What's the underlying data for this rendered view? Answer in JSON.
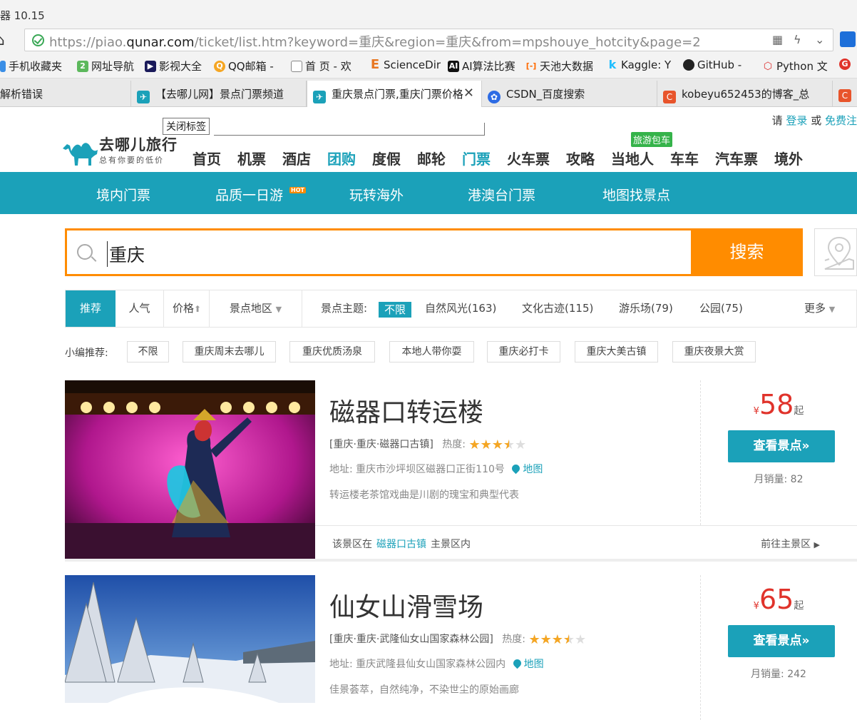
{
  "browser": {
    "title_fragment": "器 10.15",
    "url_prefix": "https://piao.",
    "url_domain": "qunar.com",
    "url_rest": "/ticket/list.htm?keyword=重庆&region=重庆&from=mpshouye_hotcity&page=2",
    "bookmarks": [
      "手机收藏夹",
      "网址导航",
      "影视大全",
      "QQ邮箱 -",
      "首 页 - 欢",
      "ScienceDir",
      "AI算法比赛",
      "天池大数据",
      "Kaggle: Y",
      "GitHub -",
      "Python 文"
    ],
    "tabs": [
      {
        "label": "解析错误"
      },
      {
        "label": "【去哪儿网】景点门票频道"
      },
      {
        "label": "重庆景点门票,重庆门票价格"
      },
      {
        "label": "CSDN_百度搜索"
      },
      {
        "label": "kobeyu652453的博客_总"
      }
    ],
    "tooltip": "关闭标签"
  },
  "header": {
    "login_prefix": "请",
    "login": "登录",
    "or": "或",
    "register": "免费注",
    "logo_title": "去哪儿旅行",
    "logo_slogan": "总有你要的低价",
    "nav": [
      "首页",
      "机票",
      "酒店",
      "团购",
      "度假",
      "邮轮",
      "门票",
      "火车票",
      "攻略",
      "当地人",
      "车车",
      "汽车票",
      "境外"
    ],
    "nav_badge": "旅游包车",
    "subnav": [
      "境内门票",
      "品质一日游",
      "玩转海外",
      "港澳台门票",
      "地图找景点"
    ],
    "hot_badge": "HOT"
  },
  "search": {
    "value": "重庆",
    "button": "搜索"
  },
  "filters": {
    "sort": [
      "推荐",
      "人气",
      "价格"
    ],
    "region": "景点地区",
    "theme_label": "景点主题:",
    "themes": [
      "不限",
      "自然风光(163)",
      "文化古迹(115)",
      "游乐场(79)",
      "公园(75)"
    ],
    "more": "更多"
  },
  "recommend": {
    "label": "小编推荐:",
    "tags": [
      "不限",
      "重庆周末去哪儿",
      "重庆优质汤泉",
      "本地人带你耍",
      "重庆必打卡",
      "重庆大美古镇",
      "重庆夜景大赏"
    ]
  },
  "results": [
    {
      "name": "磁器口转运楼",
      "location": "[重庆·重庆·磁器口古镇]",
      "heat_label": "热度:",
      "heat": 0.7,
      "address": "地址:  重庆市沙坪坝区磁器口正街110号",
      "map": "地图",
      "desc": "转运楼老茶馆戏曲是川剧的瑰宝和典型代表",
      "area_prefix": "该景区在",
      "area_name": "磁器口古镇",
      "area_suffix": "主景区内",
      "goto": "前往主景区",
      "currency": "¥",
      "price": "58",
      "price_suffix": "起",
      "button": "查看景点»",
      "sales": "月销量:  82"
    },
    {
      "name": "仙女山滑雪场",
      "location": "[重庆·重庆·武隆仙女山国家森林公园]",
      "heat_label": "热度:",
      "heat": 0.7,
      "address": "地址:  重庆武隆县仙女山国家森林公园内",
      "map": "地图",
      "desc": "佳景荟萃，自然纯净，不染世尘的原始画廊",
      "currency": "¥",
      "price": "65",
      "price_suffix": "起",
      "button": "查看景点»",
      "sales": "月销量:  242"
    }
  ],
  "colors": {
    "accent": "#1ba1b9",
    "search_orange": "#ff8c00",
    "price_red": "#e0332b",
    "star": "#f5a623"
  }
}
